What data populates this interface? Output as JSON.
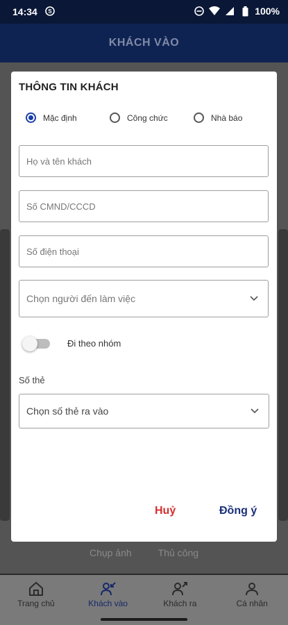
{
  "status_bar": {
    "time": "14:34",
    "battery": "100%",
    "icons": [
      "notification-icon",
      "dnd-icon",
      "wifi-icon",
      "signal-icon",
      "battery-icon"
    ]
  },
  "appbar": {
    "title": "KHÁCH VÀO"
  },
  "background": {
    "actions": [
      "Chụp ảnh",
      "Thủ công"
    ]
  },
  "dialog": {
    "title": "THÔNG TIN KHÁCH",
    "radios": [
      {
        "label": "Mặc định",
        "checked": true
      },
      {
        "label": "Công chức",
        "checked": false
      },
      {
        "label": "Nhà báo",
        "checked": false
      }
    ],
    "fields": {
      "name_placeholder": "Họ và tên khách",
      "id_placeholder": "Số CMND/CCCD",
      "phone_placeholder": "Số điện thoại",
      "host_placeholder": "Chọn người đến làm việc"
    },
    "group_toggle": {
      "label": "Đi theo nhóm",
      "on": false
    },
    "card_section_label": "Số thẻ",
    "card_select_placeholder": "Chọn số thẻ ra vào",
    "cancel_label": "Huỷ",
    "ok_label": "Đồng ý"
  },
  "bottom_nav": {
    "items": [
      {
        "label": "Trang chủ",
        "icon": "home-icon",
        "active": false
      },
      {
        "label": "Khách vào",
        "icon": "user-in-icon",
        "active": true
      },
      {
        "label": "Khách ra",
        "icon": "user-out-icon",
        "active": false
      },
      {
        "label": "Cá nhân",
        "icon": "user-icon",
        "active": false
      }
    ]
  },
  "colors": {
    "primary": "#0f2353",
    "accent": "#1a3fa8",
    "cancel": "#d32f2f",
    "ok": "#1a2f7a"
  }
}
